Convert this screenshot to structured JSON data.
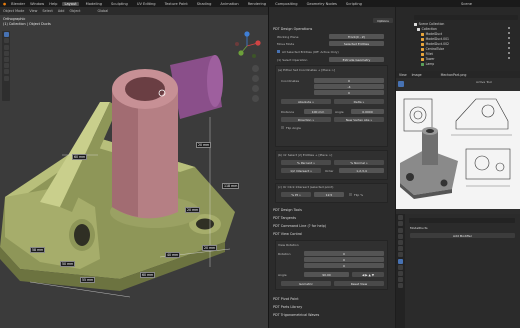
{
  "menu": {
    "items": [
      "Blender",
      "Window",
      "Help"
    ],
    "workspaces": [
      "Layout",
      "Modeling",
      "Sculpting",
      "UV Editing",
      "Texture Paint",
      "Shading",
      "Animation",
      "Rendering",
      "Compositing",
      "Geometry Nodes",
      "Scripting"
    ],
    "active_workspace": "Layout",
    "scene_label": "Scene"
  },
  "viewport": {
    "header_items": [
      "Object Mode",
      "View",
      "Select",
      "Add",
      "Object",
      "Global"
    ],
    "info_line1": "Orthographic",
    "info_line2": "(1) Collection | Object Ducts",
    "dimensions": [
      "60 mm",
      "118 mm",
      "20 mm",
      "50 mm",
      "55 mm",
      "20 mm",
      "40 mm",
      "60 mm",
      "58 mm",
      "20 mm"
    ]
  },
  "npanel": {
    "options_label": "Options",
    "header": "PDT Design Operations",
    "working_plane_label": "Working Plane",
    "working_plane_value": "Front(X - Z)",
    "move_mode_label": "Move Mode",
    "move_mode_value": "Selected Entities",
    "all_selected_label": "All Selected Entities (Off: Active Only)",
    "select_operation_label": "(1) Select Operation",
    "select_operation_value": "Extrude Geometry",
    "sub1_title": "(a) Either Set Coordinates + [Place >]",
    "coordinates_label": "Coordinates",
    "coord_x": "0",
    "coord_y": "-4",
    "coord_z": "0",
    "absolute_btn": "Absolute »",
    "delta_btn": "Delta »",
    "distance_label": "Distance",
    "distance_value": "100 mm",
    "angle_label": "Angle",
    "angle_value": "0.0000",
    "dir_btn": "Direction »",
    "new_vertex_btn": "New Vertex Abs »",
    "flip_angle_label": "Flip Angle",
    "sub2_title": "(b) Or Select |2| Entities + [Place >]",
    "percent_btn": "% Percent »",
    "normal_btn": "% Normal »",
    "intersect_btn": "1/2 Intersect »",
    "order_label": "Order",
    "order_value": "1,2,3,4",
    "sub3_title": "(c) Or Click Intersect (selected point)",
    "pct_btn1": "% Pt »",
    "pct_value": "12.5",
    "flip_pct_label": "Flip %",
    "collapsed_sections": [
      "PDT Design Tools",
      "PDT Tangents",
      "PDT Command Line (? for help)",
      "PDT View Control"
    ],
    "view_rotation_label": "View Rotation",
    "rotation_label": "Rotation",
    "rot_values": [
      "0",
      "0",
      "0"
    ],
    "angle2_label": "Angle",
    "angle2_value": "90.00",
    "isometric_btn": "Isometric",
    "reset_view_btn": "Reset View",
    "collapsed_sections_2": [
      "PDT Pivot Point",
      "PDT Parts Library",
      "PDT Trigonometrical Waves"
    ]
  },
  "outliner": {
    "title": "Scene Collection",
    "items": [
      "Collection",
      "ModelDuct",
      "ModelDuct.001",
      "ModelDuct.002",
      "CentralTube",
      "Fillet",
      "Tower",
      "Lamp"
    ]
  },
  "image_editor": {
    "header_items": [
      "View",
      "Image"
    ],
    "image_name": "MechanPart.png",
    "active_tool_label": "Active Tool"
  },
  "properties": {
    "object_name": "ModelDucts",
    "add_modifier_label": "Add Modifier"
  },
  "colors": {
    "mesh_green": "#a6ad6b",
    "mesh_pink": "#b57f84",
    "mesh_purple": "#8a4f8a",
    "accent_blue": "#4772b3"
  }
}
